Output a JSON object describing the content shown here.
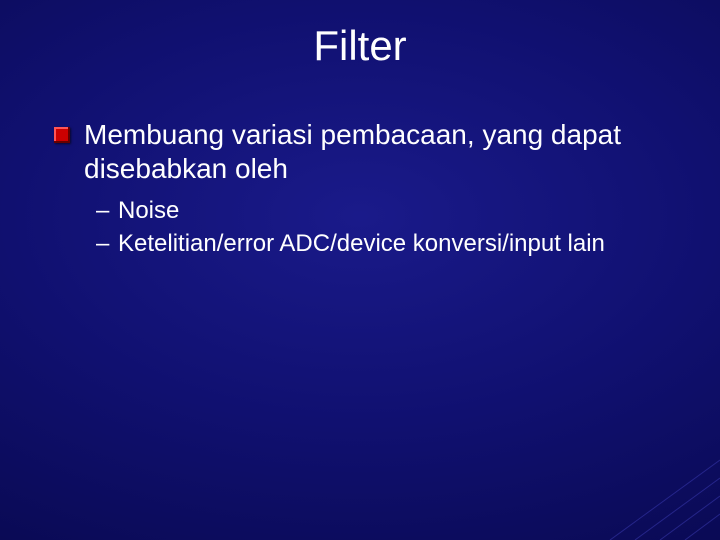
{
  "slide": {
    "title": "Filter",
    "level1_text": "Membuang variasi pembacaan, yang dapat disebabkan oleh",
    "sub1": "Noise",
    "sub2": "Ketelitian/error ADC/device konversi/input lain",
    "dash": "–"
  }
}
